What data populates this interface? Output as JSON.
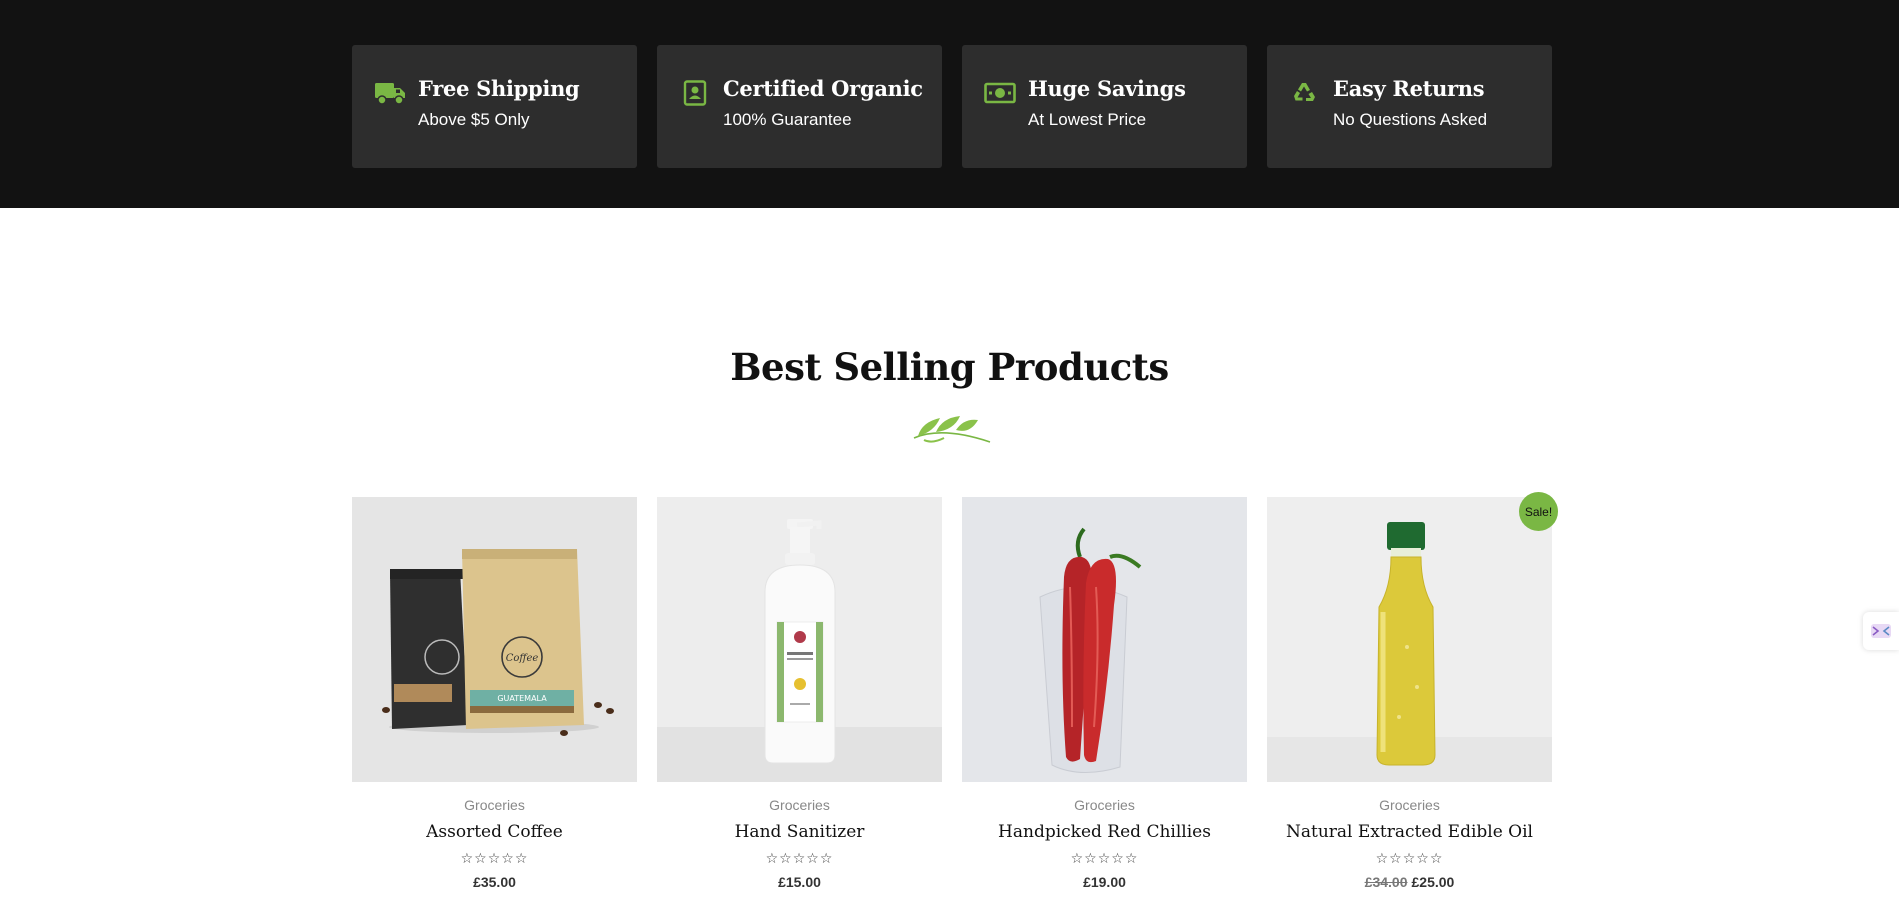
{
  "features": [
    {
      "icon": "truck-icon",
      "title": "Free Shipping",
      "subtitle": "Above $5 Only"
    },
    {
      "icon": "certificate-icon",
      "title": "Certified Organic",
      "subtitle": "100% Guarantee"
    },
    {
      "icon": "money-bill-icon",
      "title": "Huge Savings",
      "subtitle": "At Lowest Price"
    },
    {
      "icon": "recycle-icon",
      "title": "Easy Returns",
      "subtitle": "No Questions Asked"
    }
  ],
  "section": {
    "title": "Best Selling Products"
  },
  "products": [
    {
      "category": "Groceries",
      "name": "Assorted Coffee",
      "rating": 0,
      "stars": "☆☆☆☆☆",
      "price": "£35.00",
      "old_price": ""
    },
    {
      "category": "Groceries",
      "name": "Hand Sanitizer",
      "rating": 0,
      "stars": "☆☆☆☆☆",
      "price": "£15.00",
      "old_price": ""
    },
    {
      "category": "Groceries",
      "name": "Handpicked Red Chillies",
      "rating": 0,
      "stars": "☆☆☆☆☆",
      "price": "£19.00",
      "old_price": ""
    },
    {
      "category": "Groceries",
      "name": "Natural Extracted Edible Oil",
      "rating": 0,
      "stars": "☆☆☆☆☆",
      "price": "£25.00",
      "old_price": "£34.00"
    }
  ],
  "sale_badge": "Sale!",
  "colors": {
    "band": "#121212",
    "card": "#2d2d2d",
    "accent": "#7ab744"
  }
}
